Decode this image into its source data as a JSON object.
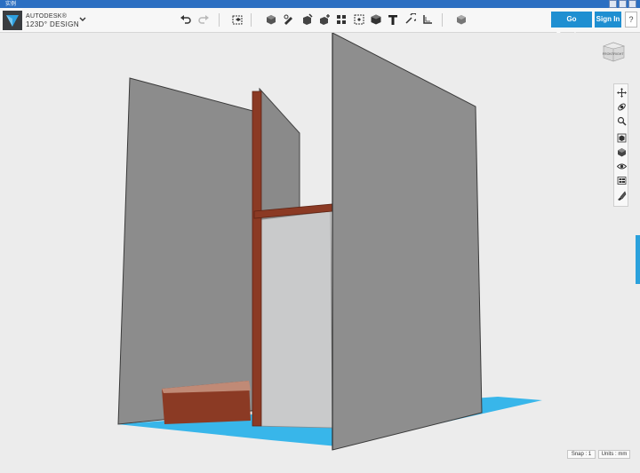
{
  "window": {
    "title_text": "实例"
  },
  "app": {
    "brand_top": "AUTODESK®",
    "brand_bottom": "123D° DESIGN"
  },
  "toolbar": {
    "icons": [
      "undo-icon",
      "redo-icon",
      "smart-box-icon",
      "primitives-icon",
      "sketch-icon",
      "construct-icon",
      "modify-icon",
      "pattern-icon",
      "grouping-icon",
      "combine-icon",
      "text-icon",
      "snap-icon",
      "measure-icon",
      "materials-icon"
    ]
  },
  "account": {
    "premium_label": "Go Premium",
    "signin_label": "Sign In",
    "help_label": "?"
  },
  "viewcube": {
    "label_front": "FRONT",
    "label_right": "RIGHT"
  },
  "navbar": {
    "icons": [
      "pan-icon",
      "orbit-icon",
      "zoom-icon",
      "fit-icon",
      "views-icon",
      "visibility-icon",
      "material-view-icon",
      "solid-settings-icon"
    ]
  },
  "status": {
    "snap_label": "Snap : 1",
    "units_label": "Units : mm"
  },
  "colors": {
    "accent": "#1f8fd1",
    "ground_plane": "#38b6ea",
    "wall": "#8e8e8e",
    "wood": "#8b3a24"
  }
}
